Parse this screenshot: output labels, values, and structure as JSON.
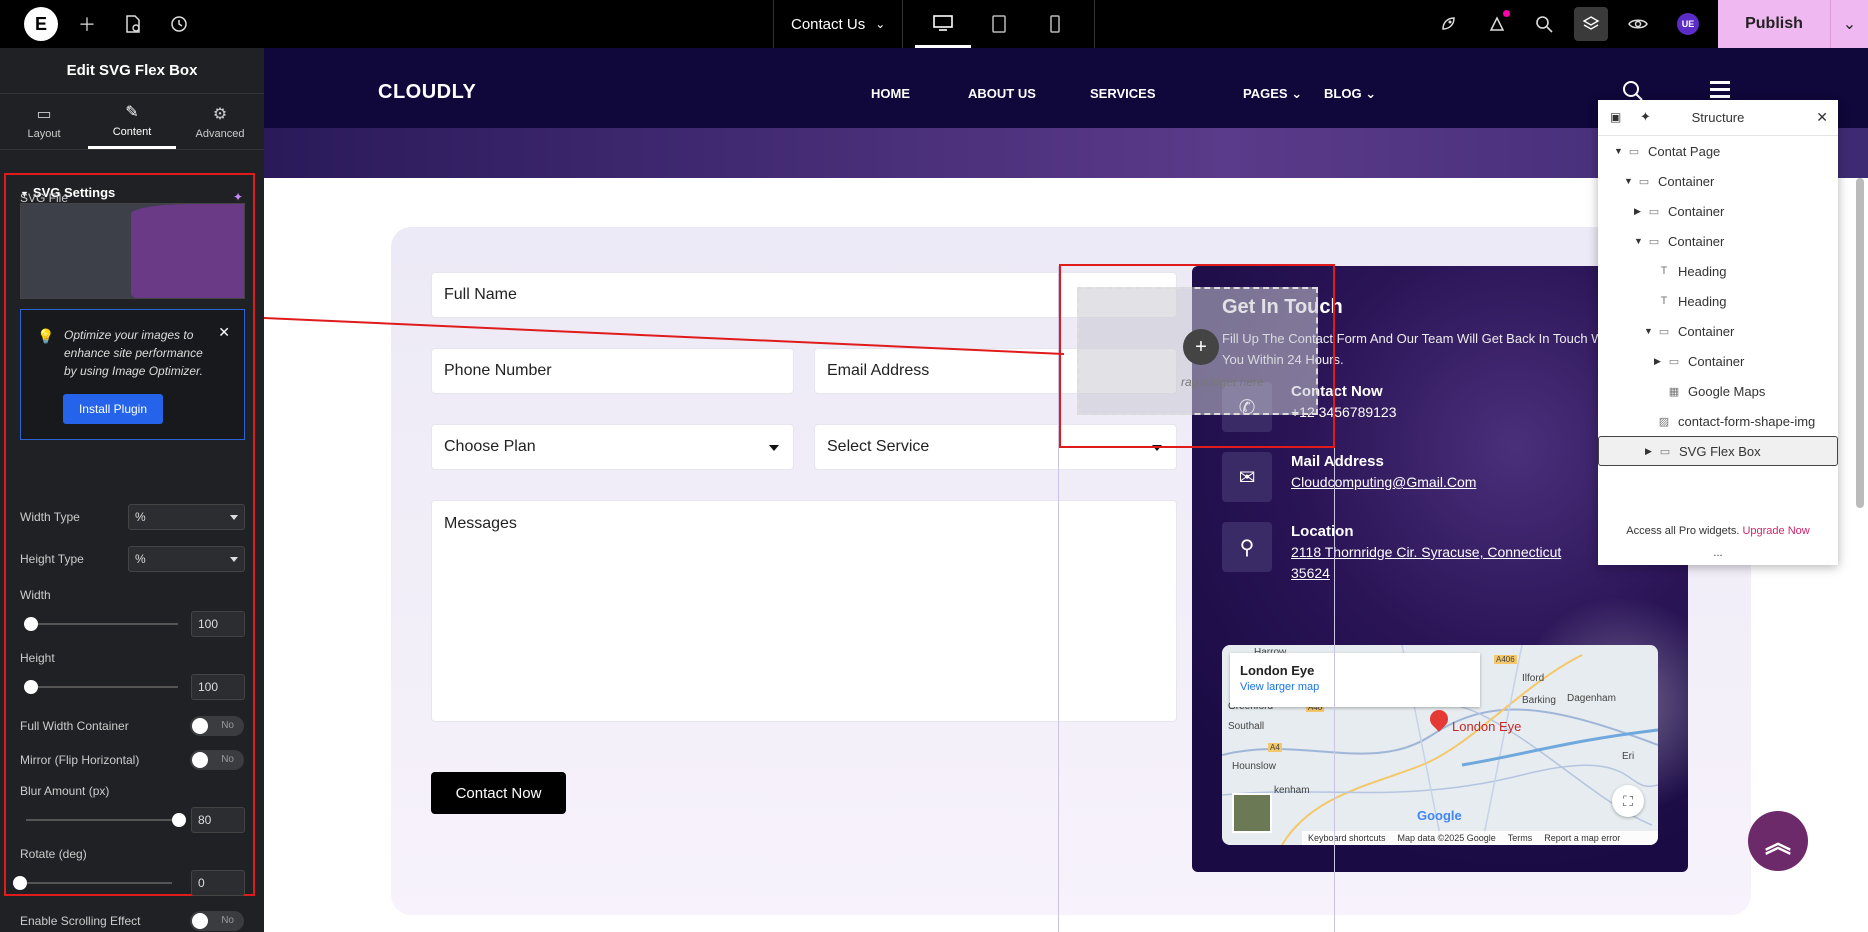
{
  "topbar": {
    "logo": "E",
    "page_name": "Contact Us",
    "publish_label": "Publish",
    "user_initials": "UE"
  },
  "panel": {
    "title": "Edit SVG Flex Box",
    "tabs": [
      {
        "label": "Layout",
        "icon": "layout-icon"
      },
      {
        "label": "Content",
        "icon": "pencil-icon"
      },
      {
        "label": "Advanced",
        "icon": "gear-icon"
      }
    ],
    "section_title": "SVG Settings",
    "svg_file_label": "SVG File",
    "optimize_text": "Optimize your images to enhance site performance by using Image Optimizer.",
    "install_plugin": "Install Plugin",
    "width_type_label": "Width Type",
    "width_type_value": "%",
    "height_type_label": "Height Type",
    "height_type_value": "%",
    "width_label": "Width",
    "width_value": "100",
    "height_label": "Height",
    "height_value": "100",
    "full_width_label": "Full Width Container",
    "full_width_value": "No",
    "mirror_label": "Mirror (Flip Horizontal)",
    "mirror_value": "No",
    "blur_label": "Blur Amount (px)",
    "blur_value": "80",
    "rotate_label": "Rotate (deg)",
    "rotate_value": "0",
    "scroll_effect_label": "Enable Scrolling Effect",
    "scroll_effect_value": "No"
  },
  "site": {
    "brand": "CLOUDLY",
    "menu": [
      "HOME",
      "ABOUT US",
      "SERVICES",
      "PAGES",
      "BLOG"
    ]
  },
  "form": {
    "full_name": "Full Name",
    "phone": "Phone Number",
    "email": "Email Address",
    "plan": "Choose Plan",
    "service": "Select Service",
    "messages": "Messages",
    "submit": "Contact Now"
  },
  "info": {
    "title": "Get In Touch",
    "subtitle": "Fill Up The Contact Form And Our Team Will Get Back In Touch With You Within 24 Hours.",
    "contact_heading": "Contact Now",
    "contact_value": "+12 3456789123",
    "mail_heading": "Mail Address",
    "mail_value": "Cloudcomputing@Gmail.Com",
    "location_heading": "Location",
    "location_value": "2118 Thornridge Cir. Syracuse, Connecticut 35624",
    "drop_hint": "rag widget here"
  },
  "map": {
    "place": "London Eye",
    "larger_map": "View larger map",
    "pin_label": "London Eye",
    "google": "Google",
    "footer": [
      "Keyboard shortcuts",
      "Map data ©2025 Google",
      "Terms",
      "Report a map error"
    ],
    "places": [
      "Harrow",
      "Ilford",
      "Barking",
      "Dagenham",
      "Greenford",
      "Southall",
      "Hounslow",
      "kenham",
      "Eri",
      "A406",
      "A40",
      "A4"
    ]
  },
  "structure": {
    "title": "Structure",
    "items": [
      {
        "label": "Contat Page",
        "icon": "container-icon"
      },
      {
        "label": "Container",
        "icon": "container-icon"
      },
      {
        "label": "Container",
        "icon": "container-icon"
      },
      {
        "label": "Container",
        "icon": "container-icon"
      },
      {
        "label": "Heading",
        "icon": "heading-icon"
      },
      {
        "label": "Heading",
        "icon": "heading-icon"
      },
      {
        "label": "Container",
        "icon": "container-icon"
      },
      {
        "label": "Container",
        "icon": "container-icon"
      },
      {
        "label": "Google Maps",
        "icon": "map-icon"
      },
      {
        "label": "contact-form-shape-img",
        "icon": "image-icon"
      },
      {
        "label": "SVG Flex Box",
        "icon": "flexbox-icon"
      }
    ],
    "footer_text": "Access all Pro widgets.",
    "footer_link": "Upgrade Now",
    "dots": "..."
  },
  "colors": {
    "accent_red": "#e01b1b",
    "publish": "#f0b8f1",
    "nav_bg": "#10073a",
    "scroll_top": "#6c2a6b"
  }
}
